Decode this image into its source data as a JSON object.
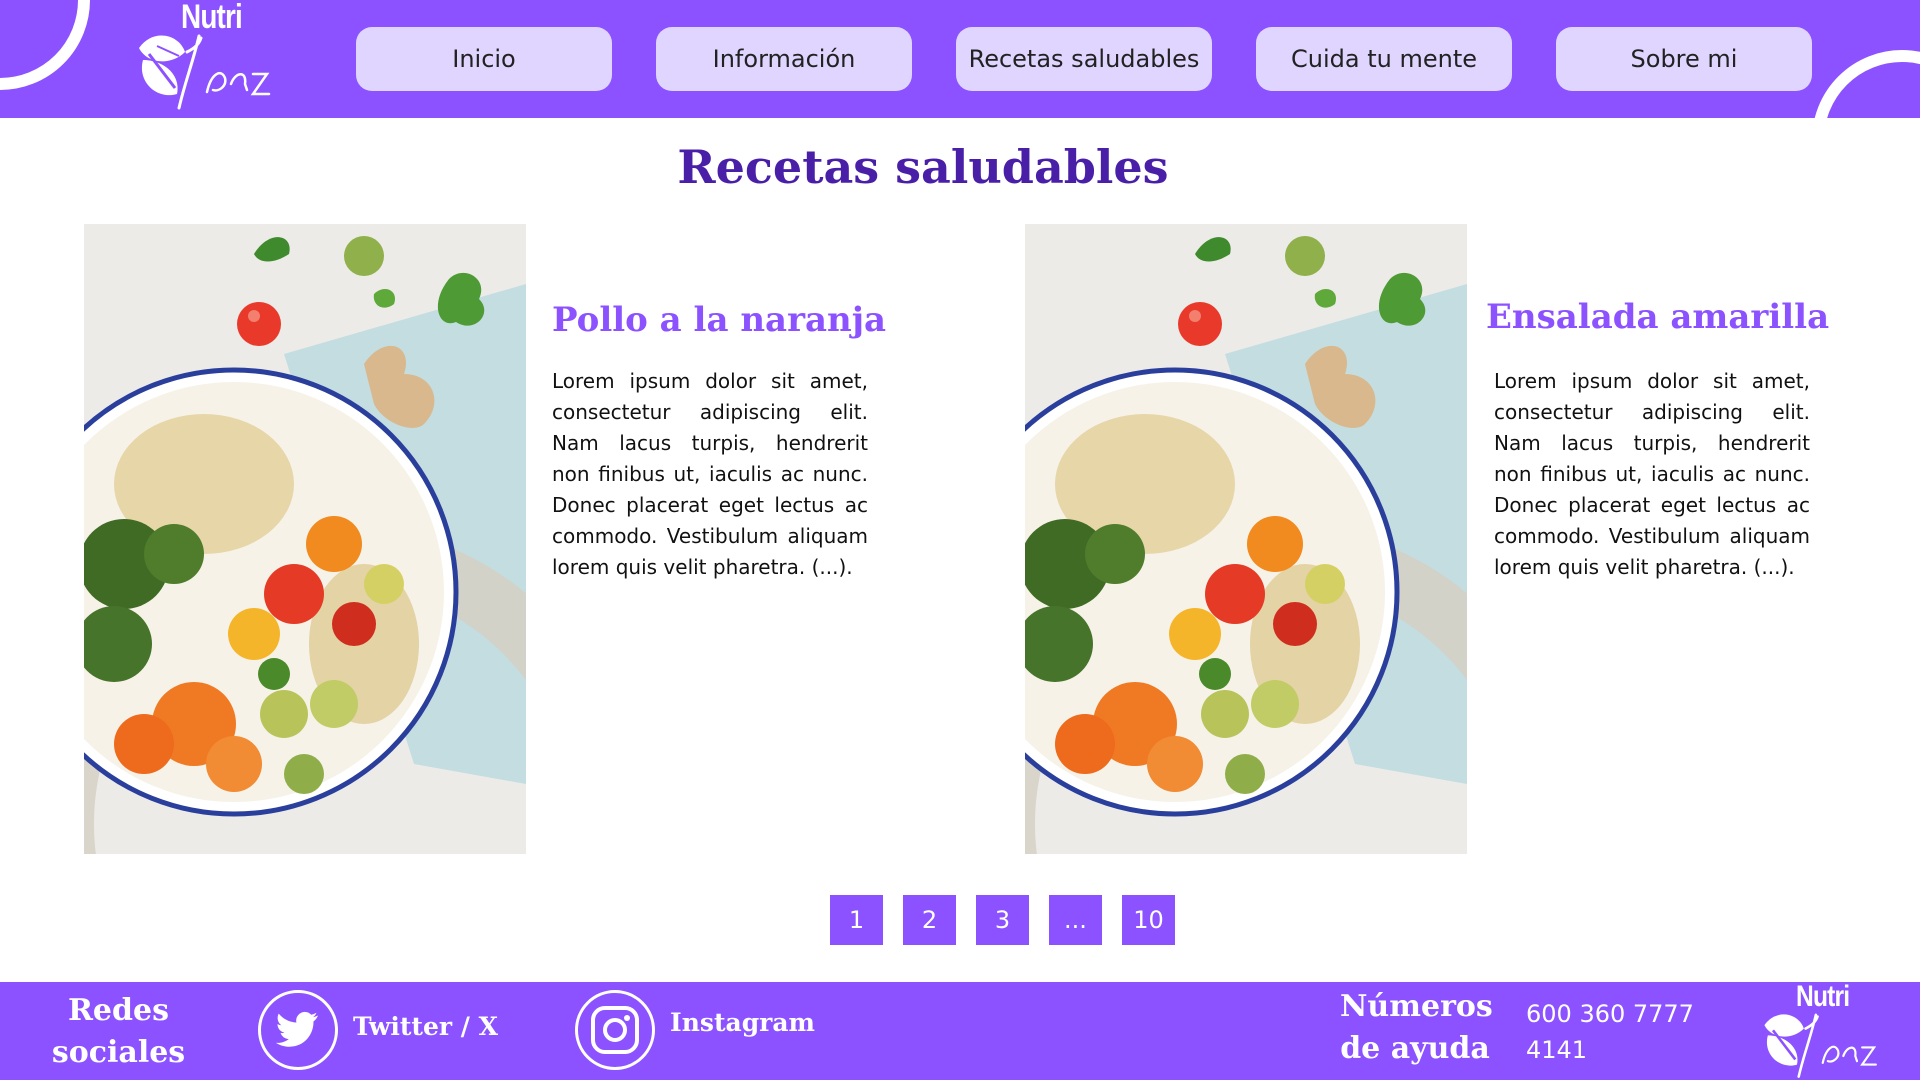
{
  "brand": {
    "name": "Nutri",
    "tagline": "Y paz"
  },
  "nav": {
    "items": [
      "Inicio",
      "Información",
      "Recetas saludables",
      "Cuida tu mente",
      "Sobre mi"
    ]
  },
  "page": {
    "title": "Recetas saludables"
  },
  "recipes": [
    {
      "title": "Pollo a la naranja",
      "text": "Lorem ipsum dolor sit amet, consectetur adipiscing elit. Nam lacus turpis, hendrerit non finibus ut, iaculis ac nunc. Donec placerat eget lectus ac commodo. Vestibulum aliquam lorem quis velit pharetra. (...)."
    },
    {
      "title": "Ensalada amarilla",
      "text": "Lorem ipsum dolor sit amet, consectetur adipiscing elit. Nam lacus turpis, hendrerit non finibus ut, iaculis ac nunc. Donec placerat eget lectus ac commodo. Vestibulum aliquam lorem quis velit pharetra. (...)."
    }
  ],
  "pagination": {
    "pages": [
      "1",
      "2",
      "3",
      "...",
      "10"
    ]
  },
  "footer": {
    "social_heading": "Redes sociales",
    "twitter_label": "Twitter / X",
    "instagram_label": "Instagram",
    "help_heading": "Números de ayuda",
    "phones": [
      "600 360 7777",
      "4141"
    ]
  },
  "colors": {
    "primary": "#8c52ff",
    "nav_button": "#e0d5ff",
    "title": "#4a1fa8",
    "recipe_title": "#8c52ff"
  },
  "icons": {
    "twitter": "twitter-bird-icon",
    "instagram": "instagram-icon",
    "logo_leaves": "leaf-icon"
  }
}
